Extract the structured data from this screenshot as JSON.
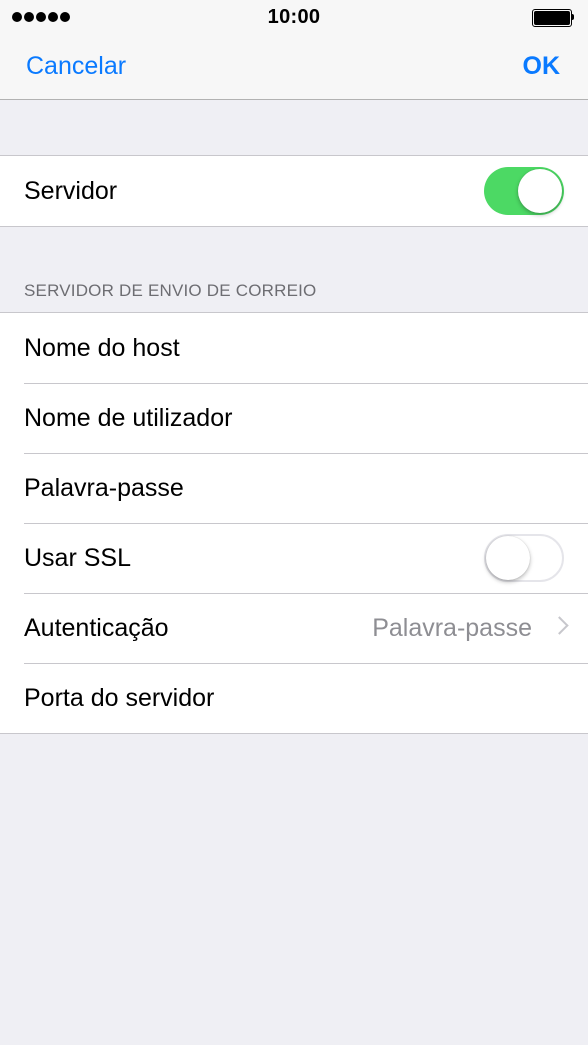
{
  "status_bar": {
    "signal_icon": "signal-dots-icon",
    "time": "10:00",
    "battery_icon": "battery-full-icon"
  },
  "nav": {
    "cancel_label": "Cancelar",
    "ok_label": "OK"
  },
  "server_group": {
    "server_label": "Servidor",
    "server_toggle": "on"
  },
  "outgoing": {
    "section_header": "SERVIDOR DE ENVIO DE CORREIO",
    "hostname_label": "Nome do host",
    "username_label": "Nome de utilizador",
    "password_label": "Palavra-passe",
    "ssl_label": "Usar SSL",
    "ssl_toggle": "off",
    "auth_label": "Autenticação",
    "auth_value": "Palavra-passe",
    "port_label": "Porta do servidor"
  },
  "colors": {
    "accent": "#0a7aff",
    "toggle_on": "#4cd964",
    "background": "#efeff4"
  }
}
